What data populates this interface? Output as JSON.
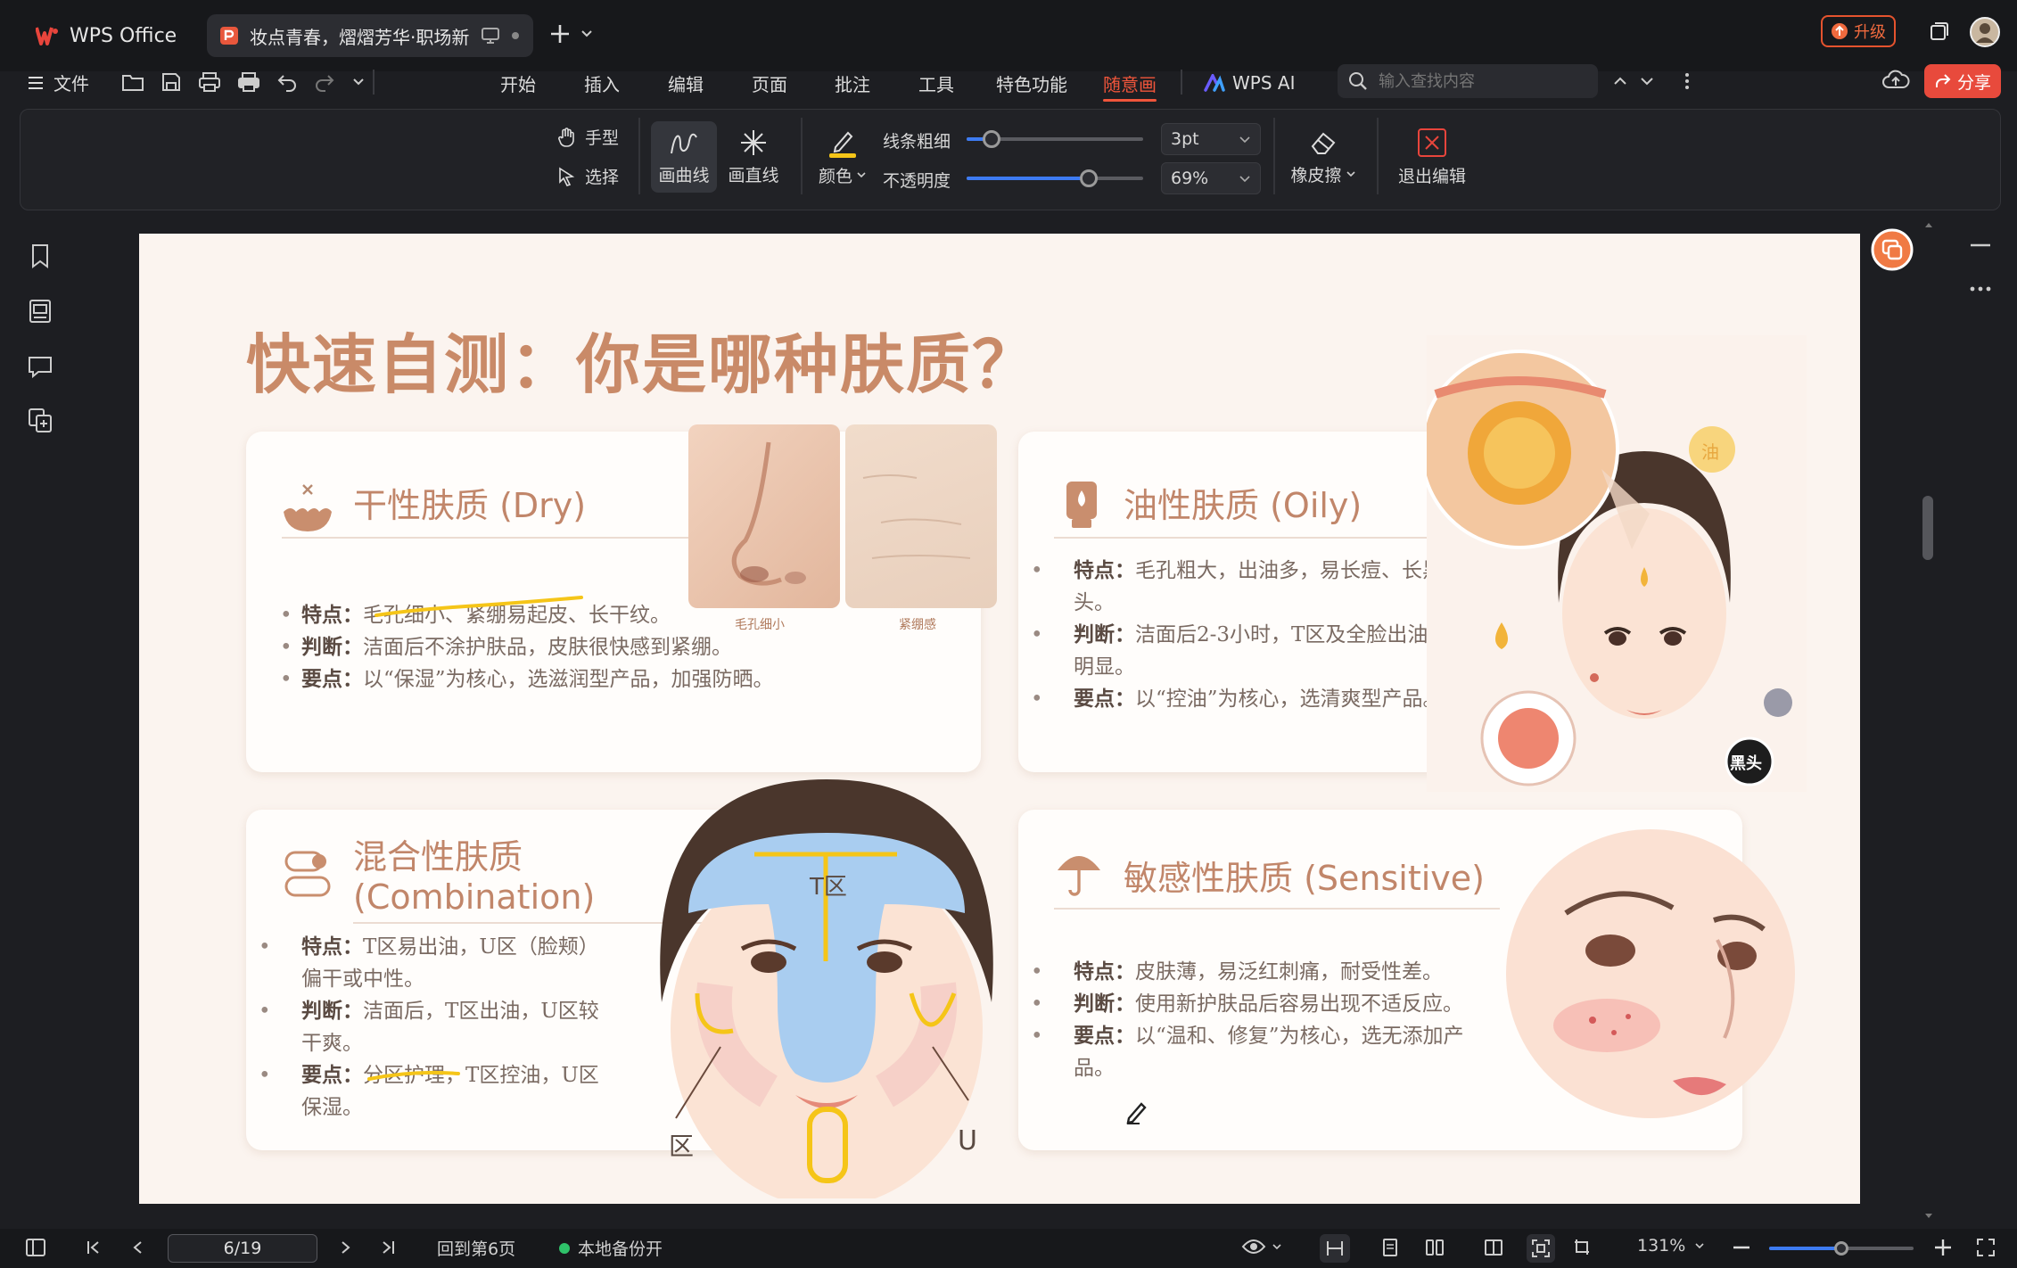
{
  "titlebar": {
    "app_name": "WPS Office",
    "doc_tab_title": "妆点青春，熠熠芳华·职场新",
    "upgrade_label": "升级"
  },
  "menubar": {
    "file_label": "文件",
    "tabs": [
      "开始",
      "插入",
      "编辑",
      "页面",
      "批注",
      "工具",
      "特色功能",
      "随意画"
    ],
    "active_tab": "随意画",
    "wps_ai_label": "WPS AI",
    "search_placeholder": "输入查找内容",
    "share_label": "分享"
  },
  "toolbar": {
    "hand_label": "手型",
    "select_label": "选择",
    "curve_label": "画曲线",
    "line_label": "画直线",
    "color_label": "颜色",
    "line_width_label": "线条粗细",
    "line_width_value": "3pt",
    "line_width_fraction": 0.14,
    "opacity_label": "不透明度",
    "opacity_value": "69%",
    "opacity_fraction": 0.69,
    "eraser_label": "橡皮擦",
    "exit_label": "退出编辑",
    "accent_color": "#f5c518"
  },
  "slide": {
    "title": "快速自测：你是哪种肤质？",
    "dry": {
      "title": "干性肤质 (Dry)",
      "bullets": [
        {
          "key": "特点：",
          "text": "毛孔细小、紧绷易起皮、长干纹。"
        },
        {
          "key": "判断：",
          "text": "洁面后不涂护肤品，皮肤很快感到紧绷。"
        },
        {
          "key": "要点：",
          "text": "以“保湿”为核心，选滋润型产品，加强防晒。"
        }
      ],
      "photo_captions": [
        "毛孔细小",
        "紧绷感"
      ]
    },
    "oily": {
      "title": "油性肤质 (Oily)",
      "bullets": [
        {
          "key": "特点：",
          "text": "毛孔粗大，出油多，易长痘、长黑头。"
        },
        {
          "key": "判断：",
          "text": "洁面后2-3小时，T区及全脸出油明显。"
        },
        {
          "key": "要点：",
          "text": "以“控油”为核心，选清爽型产品。"
        }
      ],
      "oil_badge": "油",
      "blackhead_badge": "黑头"
    },
    "combo": {
      "title_line1": "混合性肤质",
      "title_line2": "(Combination)",
      "bullets": [
        {
          "key": "特点：",
          "text": "T区易出油，U区（脸颊）偏干或中性。"
        },
        {
          "key": "判断：",
          "text": "洁面后，T区出油，U区较干爽。"
        },
        {
          "key": "要点：",
          "text": "分区护理，T区控油，U区保湿。"
        }
      ],
      "t_zone_label": "T区",
      "u_zone_left_label": "区",
      "u_zone_right_label": "U"
    },
    "sensitive": {
      "title": "敏感性肤质 (Sensitive)",
      "bullets": [
        {
          "key": "特点：",
          "text": "皮肤薄，易泛红刺痛，耐受性差。"
        },
        {
          "key": "判断：",
          "text": "使用新护肤品后容易出现不适反应。"
        },
        {
          "key": "要点：",
          "text": "以“温和、修复”为核心，选无添加产品。"
        }
      ]
    }
  },
  "statusbar": {
    "page_value": "6/19",
    "goto_label": "回到第6页",
    "backup_label": "本地备份开",
    "zoom_label": "131%",
    "zoom_fraction": 0.5
  }
}
